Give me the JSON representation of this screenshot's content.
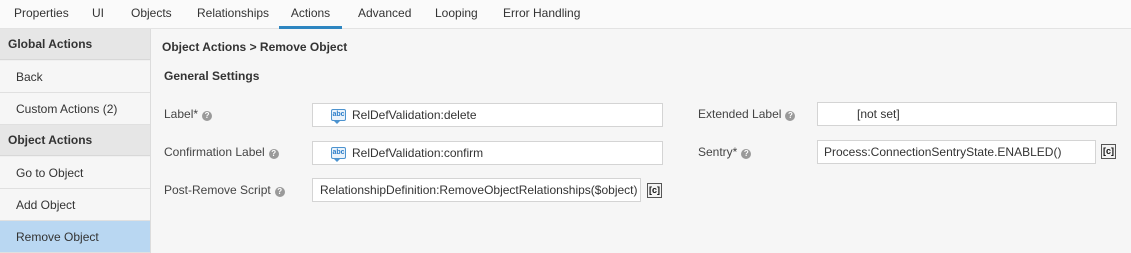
{
  "tabs": [
    "Properties",
    "UI",
    "Objects",
    "Relationships",
    "Actions",
    "Advanced",
    "Looping",
    "Error Handling"
  ],
  "active_tab": "Actions",
  "sidebar": {
    "global_header": "Global Actions",
    "global_items": [
      "Back",
      "Custom Actions (2)"
    ],
    "object_header": "Object Actions",
    "object_items": [
      "Go to Object",
      "Add Object",
      "Remove Object"
    ],
    "selected": "Remove Object"
  },
  "breadcrumb": "Object Actions > Remove Object",
  "section_title": "General Settings",
  "form": {
    "label": {
      "label": "Label*",
      "value": "RelDefValidation:delete",
      "icon": "abc-localization-icon"
    },
    "confirmation_label": {
      "label": "Confirmation Label",
      "value": "RelDefValidation:confirm",
      "icon": "abc-localization-icon"
    },
    "post_remove_script": {
      "label": "Post-Remove Script",
      "value": "RelationshipDefinition:RemoveObjectRelationships($object)",
      "button": "[c]"
    },
    "extended_label": {
      "label": "Extended Label",
      "value": "[not set]"
    },
    "sentry": {
      "label": "Sentry*",
      "value": "Process:ConnectionSentryState.ENABLED()",
      "button": "[c]"
    }
  },
  "help_glyph": "?",
  "abc_glyph": "abc",
  "colors": {
    "accent": "#2e86c1",
    "selected_bg": "#b9d7f2",
    "abc_blue": "#2a7dc9"
  }
}
